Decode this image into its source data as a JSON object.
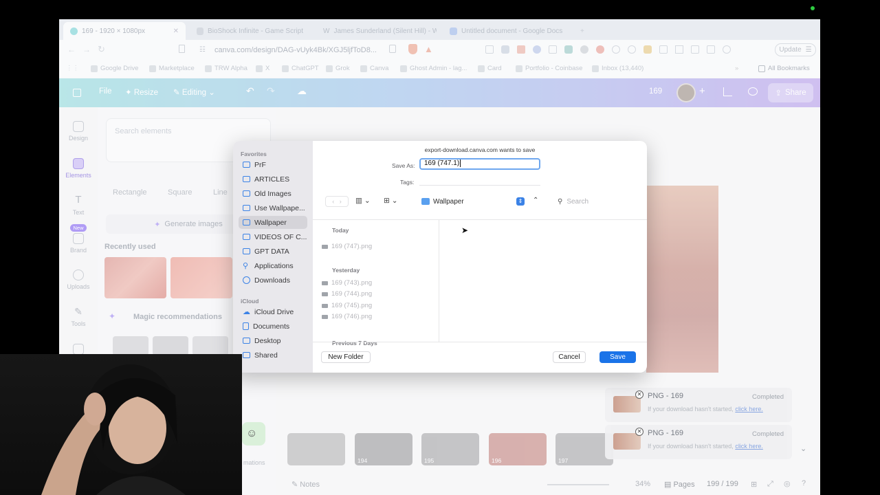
{
  "browser": {
    "tabs": [
      {
        "title": "169 - 1920 × 1080px",
        "active": true
      },
      {
        "title": "BioShock Infinite - Game Script",
        "active": false
      },
      {
        "title": "James Sunderland (Silent Hill) - W",
        "active": false
      },
      {
        "title": "Untitled document - Google Docs",
        "active": false
      }
    ],
    "url": "canva.com/design/DAG-vUyk4Bk/XGJ5ljfToD8...",
    "update_label": "Update",
    "bookmarks": [
      "Google Drive",
      "Marketplace",
      "TRW Alpha",
      "X",
      "ChatGPT",
      "Grok",
      "Canva",
      "Ghost Admin - lag...",
      "Card",
      "Portfolio - Coinbase",
      "Inbox (13,440)"
    ],
    "all_bookmarks_label": "All Bookmarks"
  },
  "canva": {
    "menu": {
      "file": "File",
      "resize": "Resize",
      "editing": "Editing"
    },
    "design_name": "169",
    "share_label": "Share",
    "rail": [
      "Design",
      "Elements",
      "Text",
      "Brand",
      "Uploads",
      "Tools"
    ],
    "brand_badge": "New",
    "search_placeholder": "Search elements",
    "shapes": [
      "Rectangle",
      "Square",
      "Line"
    ],
    "generate_label": "Generate images",
    "recently_used": "Recently used",
    "magic_label": "Magic recommendations",
    "animations_label": "mations",
    "pages": [
      "194",
      "195",
      "196",
      "197"
    ],
    "notes_label": "Notes",
    "zoom": "34%",
    "pages_label": "Pages",
    "page_count": "199 / 199"
  },
  "toasts": [
    {
      "title": "PNG - 169",
      "status": "Completed",
      "message": "If your download hasn't started,",
      "link": "click here."
    },
    {
      "title": "PNG - 169",
      "status": "Completed",
      "message": "If your download hasn't started,",
      "link": "click here."
    }
  ],
  "dialog": {
    "prompt": "export-download.canva.com wants to save",
    "save_as_label": "Save As:",
    "save_as_value": "169 (747.1)",
    "tags_label": "Tags:",
    "location": "Wallpaper",
    "search_placeholder": "Search",
    "favorites_header": "Favorites",
    "favorites": [
      "PrF",
      "ARTICLES",
      "Old Images",
      "Use Wallpape...",
      "Wallpaper",
      "VIDEOS OF C...",
      "GPT DATA",
      "Applications",
      "Downloads"
    ],
    "icloud_header": "iCloud",
    "icloud": [
      "iCloud Drive",
      "Documents",
      "Desktop",
      "Shared"
    ],
    "groups": {
      "today": "Today",
      "today_files": [
        "169 (747).png"
      ],
      "yesterday": "Yesterday",
      "yesterday_files": [
        "169 (743).png",
        "169 (744).png",
        "169 (745).png",
        "169 (746).png"
      ],
      "previous": "Previous 7 Days"
    },
    "new_folder_label": "New Folder",
    "cancel_label": "Cancel",
    "save_label": "Save",
    "accent": "#1a73e8"
  }
}
